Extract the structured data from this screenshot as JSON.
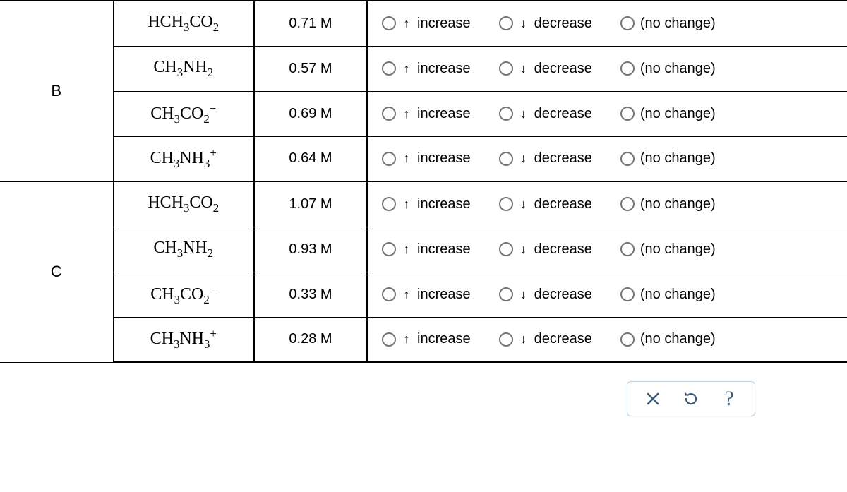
{
  "options": {
    "increase": "increase",
    "decrease": "decrease",
    "nochange": "(no change)"
  },
  "arrows": {
    "up": "↑",
    "down": "↓"
  },
  "groups": [
    {
      "label": "B",
      "rows": [
        {
          "formula": "HCH<sub>3</sub>CO<sub>2</sub>",
          "conc": "0.71 M"
        },
        {
          "formula": "CH<sub>3</sub>NH<sub>2</sub>",
          "conc": "0.57 M"
        },
        {
          "formula": "CH<sub>3</sub>CO<sub>2</sub><sup>−</sup>",
          "conc": "0.69 M"
        },
        {
          "formula": "CH<sub>3</sub>NH<sub>3</sub><sup>+</sup>",
          "conc": "0.64 M"
        }
      ]
    },
    {
      "label": "C",
      "rows": [
        {
          "formula": "HCH<sub>3</sub>CO<sub>2</sub>",
          "conc": "1.07 M"
        },
        {
          "formula": "CH<sub>3</sub>NH<sub>2</sub>",
          "conc": "0.93 M"
        },
        {
          "formula": "CH<sub>3</sub>CO<sub>2</sub><sup>−</sup>",
          "conc": "0.33 M"
        },
        {
          "formula": "CH<sub>3</sub>NH<sub>3</sub><sup>+</sup>",
          "conc": "0.28 M"
        }
      ]
    }
  ],
  "toolbar": {
    "close": "×",
    "reset": "↺",
    "help": "?"
  }
}
